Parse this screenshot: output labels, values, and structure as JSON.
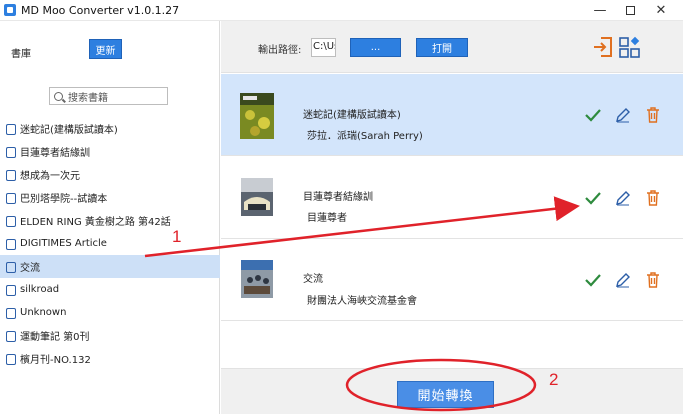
{
  "window": {
    "title": "MD Moo Converter v1.0.1.27"
  },
  "sidebar": {
    "library_label": "書庫",
    "refresh_label": "更新",
    "search_placeholder": "搜索書籍",
    "books": [
      {
        "title": "迷蛇記(建構版試讀本)"
      },
      {
        "title": "目蓮尊者結緣訓"
      },
      {
        "title": "想成為一次元"
      },
      {
        "title": "巴別塔學院--試讀本"
      },
      {
        "title": "ELDEN RING 黃金樹之路 第42話"
      },
      {
        "title": "DIGITIMES Article"
      },
      {
        "title": "交流",
        "selected": true
      },
      {
        "title": "silkroad"
      },
      {
        "title": "Unknown"
      },
      {
        "title": "運動筆記 第0刊"
      },
      {
        "title": "檳月刊-NO.132"
      }
    ]
  },
  "toolbar": {
    "output_label": "輸出路徑:",
    "output_path": "C:\\Us",
    "browse_label": "...",
    "open_label": "打開"
  },
  "queue": [
    {
      "title": "迷蛇記(建構版試讀本)",
      "author": "莎拉．派瑞(Sarah Perry)",
      "active": true
    },
    {
      "title": "目蓮尊者結緣訓",
      "author": "目蓮尊者"
    },
    {
      "title": "交流",
      "author": "財團法人海峽交流基金會"
    }
  ],
  "convert": {
    "label": "開始轉換"
  },
  "annotations": {
    "label_1": "1",
    "label_2": "2"
  },
  "colors": {
    "accent": "#2d7fe0",
    "check": "#2e8b3e",
    "trash": "#e07020",
    "annotation": "#e0222a"
  }
}
